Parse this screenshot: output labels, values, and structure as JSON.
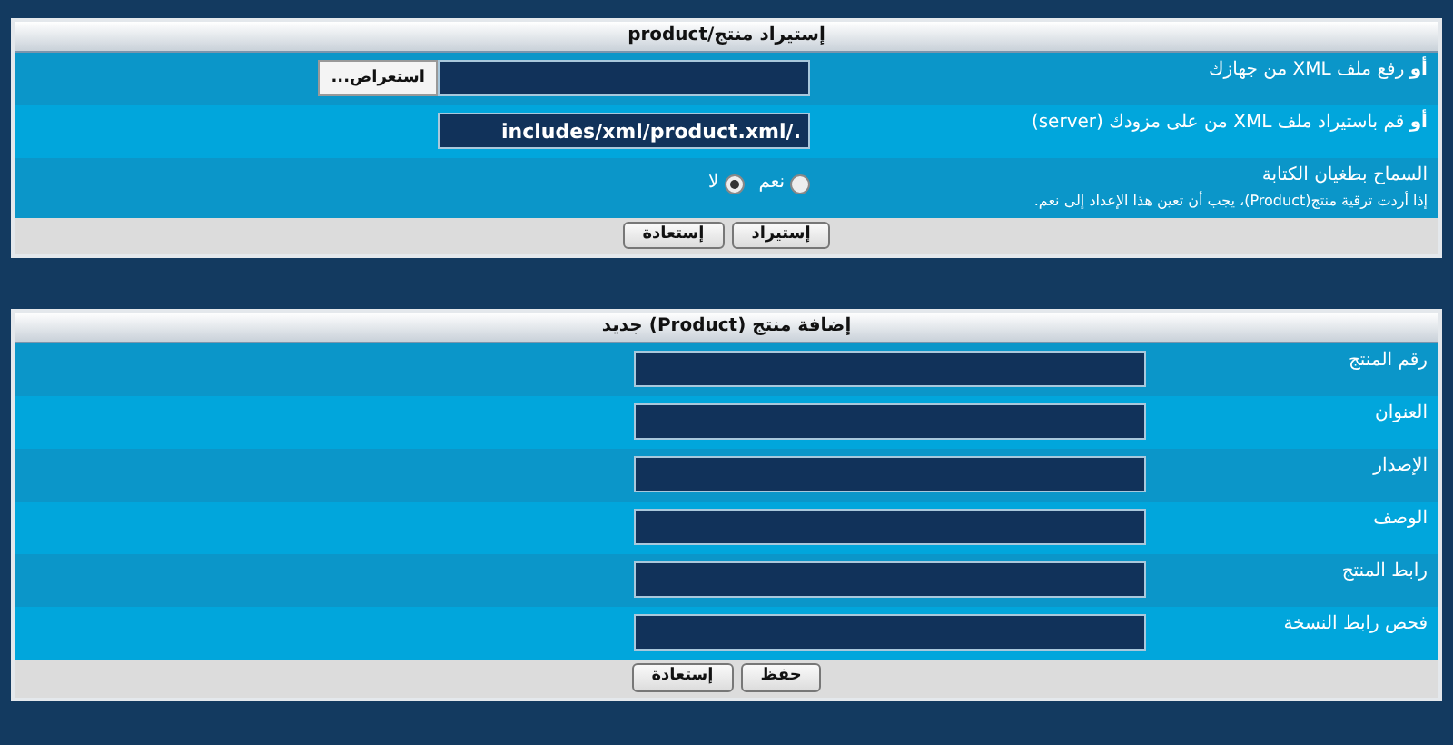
{
  "import_form": {
    "title": "إستيراد منتج/product",
    "rows": [
      {
        "kind": "file",
        "label": "**أو** رفع ملف XML من جهازك",
        "value": "",
        "button": "استعراض..."
      },
      {
        "kind": "text",
        "label": "**أو** قم باستيراد ملف XML من على مزودك (server)",
        "value": "./includes/xml/product.xml"
      },
      {
        "kind": "radio",
        "label": "السماح بطغيان الكتابة",
        "description": "إذا أردت ترقية منتج(Product)، يجب أن تعين هذا الإعداد إلى نعم.",
        "options": [
          {
            "label": "نعم",
            "selected": false
          },
          {
            "label": "لا",
            "selected": true
          }
        ]
      }
    ],
    "buttons": [
      "إستيراد",
      "إستعادة"
    ]
  },
  "add_form": {
    "title": "إضافة منتج (Product) جديد",
    "rows": [
      {
        "kind": "text",
        "label": "رقم المنتج",
        "value": ""
      },
      {
        "kind": "text",
        "label": "العنوان",
        "value": ""
      },
      {
        "kind": "text",
        "label": "الإصدار",
        "value": ""
      },
      {
        "kind": "text",
        "label": "الوصف",
        "value": ""
      },
      {
        "kind": "text",
        "label": "رابط المنتج",
        "value": ""
      },
      {
        "kind": "text",
        "label": "فحص رابط النسخة",
        "value": ""
      }
    ],
    "buttons": [
      "حفظ",
      "إستعادة"
    ]
  }
}
